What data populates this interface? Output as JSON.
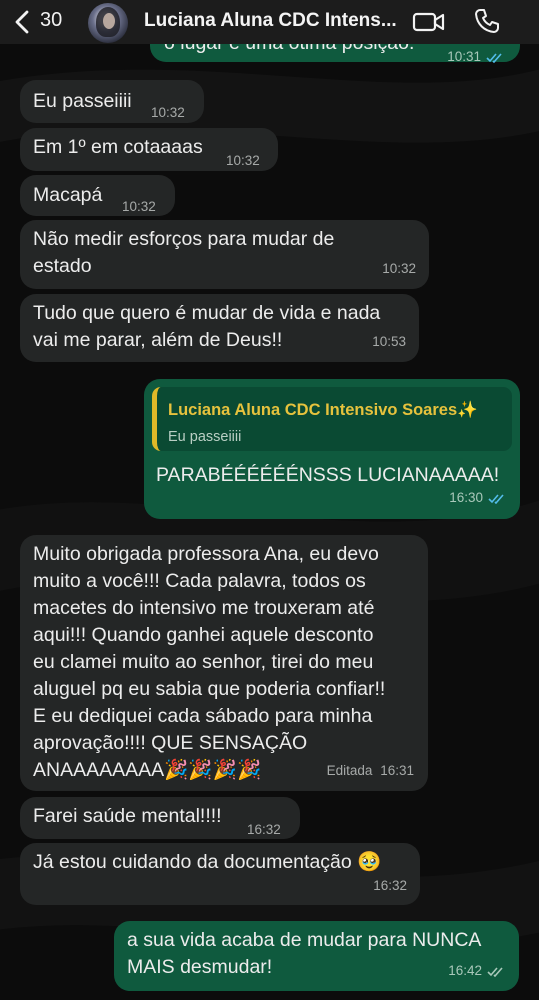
{
  "header": {
    "unread_count": "30",
    "chat_title": "Luciana Aluna CDC Intens..."
  },
  "messages": [
    {
      "type": "out",
      "text": "o lugar é uma ótima posição.",
      "time": "10:31",
      "status": "read"
    },
    {
      "type": "in",
      "text": "Eu passeiiii",
      "time": "10:32"
    },
    {
      "type": "in",
      "text": "Em 1º em cotaaaas",
      "time": "10:32"
    },
    {
      "type": "in",
      "text": "Macapá",
      "time": "10:32"
    },
    {
      "type": "in",
      "text": "Não medir esforços para mudar de\nestado",
      "time": "10:32"
    },
    {
      "type": "in",
      "text": "Tudo que quero é mudar de vida e nada\nvai me parar, além de Deus!!",
      "time": "10:53"
    },
    {
      "type": "out",
      "text": "PARABÉÉÉÉÉÉNSSS LUCIANAAAAA!",
      "time": "16:30",
      "status": "read",
      "reply": {
        "author": "Luciana Aluna CDC Intensivo Soares✨",
        "text": "Eu passeiiii"
      }
    },
    {
      "type": "in",
      "text": "Muito obrigada professora Ana, eu devo\nmuito a você!!! Cada palavra, todos os\nmacetes do intensivo me trouxeram até\naqui!!! Quando ganhei aquele desconto\neu clamei muito ao senhor, tirei do meu\naluguel pq eu sabia que poderia confiar!!\nE eu dediquei cada sábado para minha\naprovação!!!! QUE SENSAÇÃO\nANAAAAAAAA🎉🎉🎉🎉",
      "edited_label": "Editada",
      "time": "16:31"
    },
    {
      "type": "in",
      "text": "Farei saúde mental!!!!",
      "time": "16:32"
    },
    {
      "type": "in",
      "text": "Já estou cuidando da documentação 🥹",
      "time": "16:32"
    },
    {
      "type": "out",
      "text": "a sua vida acaba de mudar para NUNCA\nMAIS desmudar!",
      "time": "16:42",
      "status": "delivered"
    }
  ],
  "colors": {
    "background": "#0c0c0c",
    "incoming_bubble": "#242626",
    "outgoing_bubble": "#0f5a3e",
    "read_tick": "#53bdeb",
    "quote_accent": "#e0b928"
  }
}
